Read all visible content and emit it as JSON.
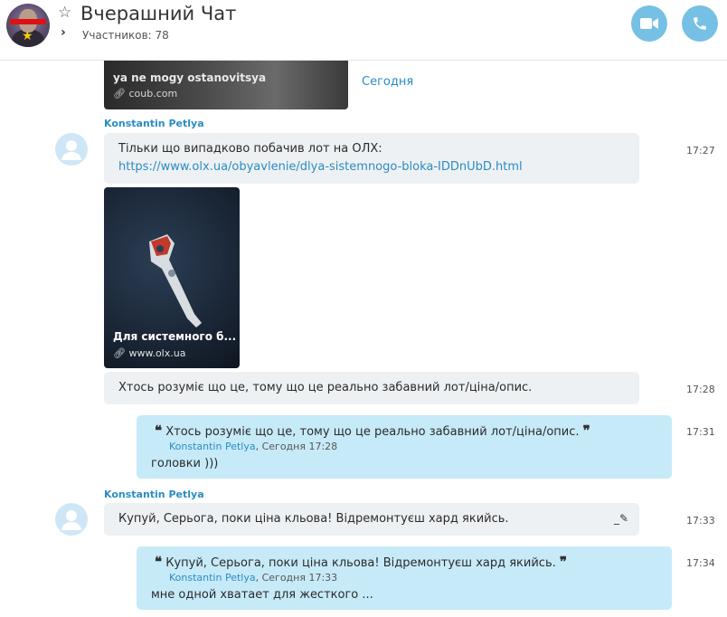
{
  "header": {
    "title": "Вчерашний Чат",
    "participants": "Участников: 78"
  },
  "icons": {
    "favorite": "star-outline-icon",
    "expand": "chevron-right-icon",
    "video": "video-camera-icon",
    "phone": "phone-icon",
    "link": "link-icon",
    "edit": "edit-pencil-icon"
  },
  "colors": {
    "accent": "#2a8cc4",
    "call_button": "#76c0e6",
    "incoming_bubble": "#eef1f3",
    "outgoing_bubble": "#c7eaf9"
  },
  "coub_preview": {
    "title": "ya ne mogy ostanovitsya",
    "domain": "coub.com",
    "time_label": "Сегодня"
  },
  "messages": [
    {
      "sender": "Konstantin Petlya",
      "text": "Тільки що випадково побачив лот на ОЛХ:",
      "link": "https://www.olx.ua/obyavlenie/dlya-sistemnogo-bloka-IDDnUbD.html",
      "time": "17:27"
    },
    {
      "preview_title": "Для системного б...",
      "preview_domain": "www.olx.ua"
    },
    {
      "text": "Хтось розуміє що це, тому що це реально забавний лот/ціна/опис.",
      "time": "17:28"
    },
    {
      "quote_text": "Хтось розуміє що це, тому що це реально забавний лот/ціна/опис.",
      "quote_author": "Konstantin Petlya",
      "quote_date": ", Сегодня 17:28",
      "text": "головки )))",
      "time": "17:31"
    },
    {
      "sender": "Konstantin Petlya",
      "text": "Купуй, Серьога, поки ціна кльова! Відремонтуєш хард якийсь.",
      "time": "17:33"
    },
    {
      "quote_text": "Купуй, Серьога, поки ціна кльова! Відремонтуєш хард якийсь.",
      "quote_author": "Konstantin Petlya",
      "quote_date": ", Сегодня 17:33",
      "text": "мне одной хватает для жесткого ...",
      "time": "17:34"
    }
  ]
}
